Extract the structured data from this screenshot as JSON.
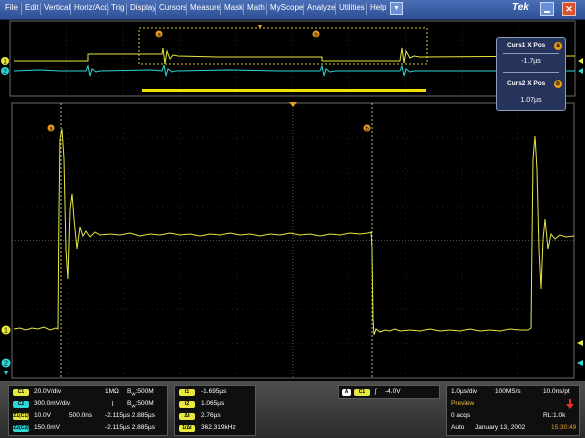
{
  "menu": {
    "items": [
      "File",
      "Edit",
      "Vertical",
      "Horiz/Acq",
      "Trig",
      "Display",
      "Cursors",
      "Measure",
      "Mask",
      "Math",
      "MyScope",
      "Analyze",
      "Utilities",
      "Help"
    ],
    "dropdown_glyph": "▼",
    "logo": "Tek",
    "close_glyph": "✕"
  },
  "overview_markers": {
    "cursor1": "a",
    "cursor2": "b",
    "ch1": "1",
    "ch2": "2"
  },
  "main_markers": {
    "cursor1": "a",
    "cursor2": "b",
    "ch1": "1",
    "ch2": "2"
  },
  "cursor_readout": {
    "curs1_label": "Curs1 X Pos",
    "curs1_badge": "a",
    "curs1_value": "-1.7µs",
    "curs2_label": "Curs2 X Pos",
    "curs2_badge": "b",
    "curs2_value": "1.07µs"
  },
  "channels": {
    "ch1": {
      "badge": "C1",
      "scale": "20.0V/div",
      "impedance": "1MΩ",
      "bw": "B",
      "bw_sub": "W",
      "bw_value": ":500M"
    },
    "ch2": {
      "badge": "C2",
      "scale": "300.0mV/div",
      "coupling": "⌇",
      "bw": "B",
      "bw_sub": "W",
      "bw_value": ":500M"
    },
    "z1": {
      "badge": "Z1(C1)",
      "scale": "10.0V",
      "pos": "500.0ns",
      "range": "-2.115µs 2.885µs"
    },
    "z2": {
      "badge": "Z2(C2)",
      "scale": "150.0mV",
      "range": "-2.115µs 2.885µs"
    }
  },
  "cursor_measure": {
    "t1_badge": "t1",
    "t1": "-1.695µs",
    "t2_badge": "t2",
    "t2": "1.065µs",
    "dt_badge": "Δt",
    "dt": "2.76µs",
    "freq_badge": "1/Δt",
    "freq": "362.319kHz"
  },
  "trigger": {
    "mode_badge": "A",
    "source_badge": "C1",
    "slope": "ʃ",
    "level": "-4.0V"
  },
  "acquisition": {
    "timebase": "1.0µs/div",
    "sample_rate": "100MS/s",
    "resolution": "10.0ns/pt",
    "state": "Preview",
    "acqs": "0 acqs",
    "record_length": "RL:1.0k",
    "trigger_mode": "Auto",
    "date": "January 13, 2002",
    "time": "15:30:49"
  },
  "colors": {
    "ch1": "#e8e840",
    "ch2": "#2fd6d6",
    "cursor": "#e69a1b",
    "menubar": "#3a5ea8",
    "time": "#f0a020"
  }
}
